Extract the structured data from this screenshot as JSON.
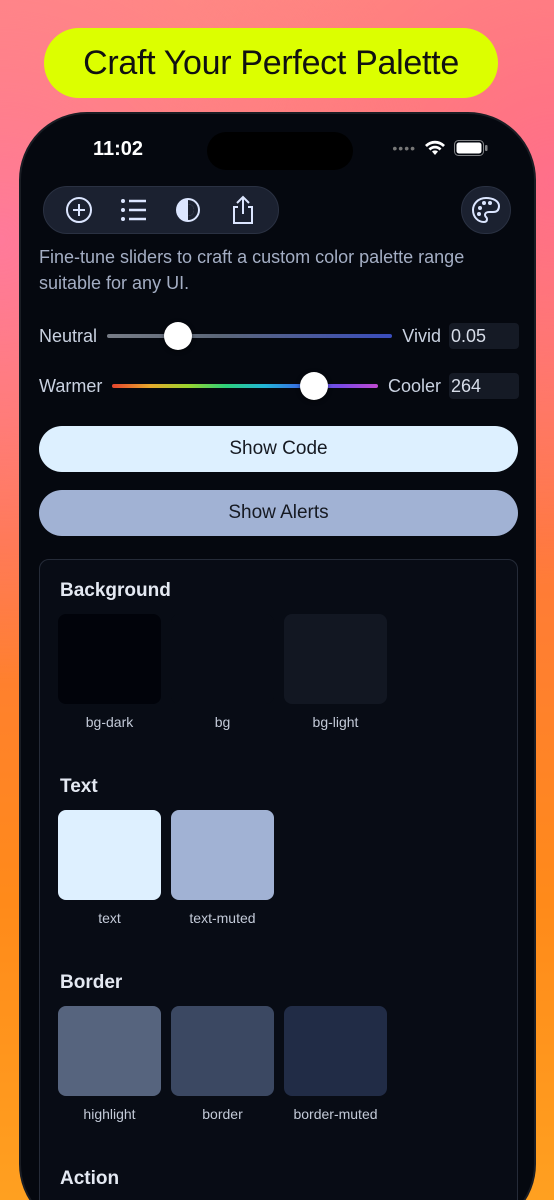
{
  "headline": "Craft Your Perfect Palette",
  "status": {
    "time": "11:02",
    "signal_icon": "cellular-dots-icon",
    "wifi_icon": "wifi-icon",
    "battery_icon": "battery-icon"
  },
  "toolbar": {
    "icons": [
      "add-circle-icon",
      "list-icon",
      "contrast-icon",
      "share-icon"
    ],
    "palette_icon": "palette-icon"
  },
  "description": "Fine-tune sliders to craft a custom color palette range suitable for any UI.",
  "sliders": {
    "saturation": {
      "left_label": "Neutral",
      "right_label": "Vivid",
      "value": "0.05",
      "position": 0.25
    },
    "hue": {
      "left_label": "Warmer",
      "right_label": "Cooler",
      "value": "264",
      "position": 0.76
    }
  },
  "buttons": {
    "show_code": "Show Code",
    "show_alerts": "Show Alerts"
  },
  "colors": {
    "bg-dark": "#01030a",
    "bg": "#080c15",
    "bg-light": "#121722",
    "text": "#def0ff",
    "text-muted": "#a1b2d4",
    "highlight": "#56647e",
    "border": "#3b4862",
    "border-muted": "#212c46",
    "button_primary": "#ddf0ff",
    "button_secondary": "#a1b2d4",
    "headline_bg": "#dcff00"
  },
  "sections": [
    {
      "title": "Background",
      "swatches": [
        "bg-dark",
        "bg",
        "bg-light"
      ]
    },
    {
      "title": "Text",
      "swatches": [
        "text",
        "text-muted"
      ]
    },
    {
      "title": "Border",
      "swatches": [
        "highlight",
        "border",
        "border-muted"
      ]
    },
    {
      "title": "Action",
      "swatches": []
    }
  ]
}
